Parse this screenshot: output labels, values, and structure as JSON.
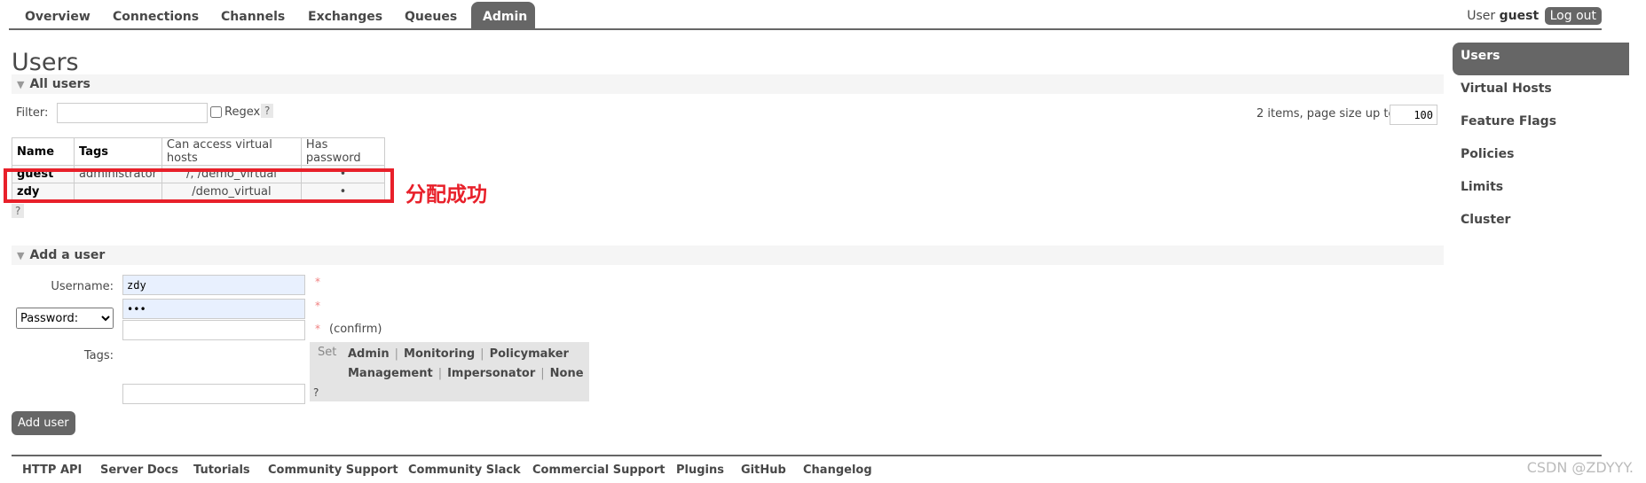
{
  "nav": {
    "tabs": [
      "Overview",
      "Connections",
      "Channels",
      "Exchanges",
      "Queues",
      "Admin"
    ],
    "active": "Admin"
  },
  "header": {
    "user_prefix": "User",
    "user": "guest",
    "logout": "Log out"
  },
  "page_title": "Users",
  "all_users": {
    "title": "All users",
    "filter_label": "Filter:",
    "filter_value": "",
    "regex_label": "Regex",
    "help": "?",
    "pagination": "2 items, page size up to",
    "page_size": "100",
    "columns": [
      "Name",
      "Tags",
      "Can access virtual hosts",
      "Has password"
    ],
    "rows": [
      {
        "name": "guest",
        "tags": "administrator",
        "vhosts": "/, /demo_virtual",
        "has_password": "•"
      },
      {
        "name": "zdy",
        "tags": "",
        "vhosts": "/demo_virtual",
        "has_password": "•"
      }
    ]
  },
  "annotation": "分配成功",
  "add_user": {
    "title": "Add a user",
    "username_label": "Username:",
    "username_value": "zdy",
    "password_select": "Password:",
    "password_value": "•••",
    "confirm": "(confirm)",
    "tags_label": "Tags:",
    "required": "*",
    "set_label": "Set",
    "tags": [
      "Admin",
      "Monitoring",
      "Policymaker",
      "Management",
      "Impersonator",
      "None"
    ],
    "help": "?",
    "button": "Add user"
  },
  "sidebar": {
    "items": [
      "Users",
      "Virtual Hosts",
      "Feature Flags",
      "Policies",
      "Limits",
      "Cluster"
    ],
    "active": "Users"
  },
  "footer": {
    "links": [
      "HTTP API",
      "Server Docs",
      "Tutorials",
      "Community Support",
      "Community Slack",
      "Commercial Support",
      "Plugins",
      "GitHub",
      "Changelog"
    ],
    "watermark": "CSDN @ZDYYY."
  }
}
